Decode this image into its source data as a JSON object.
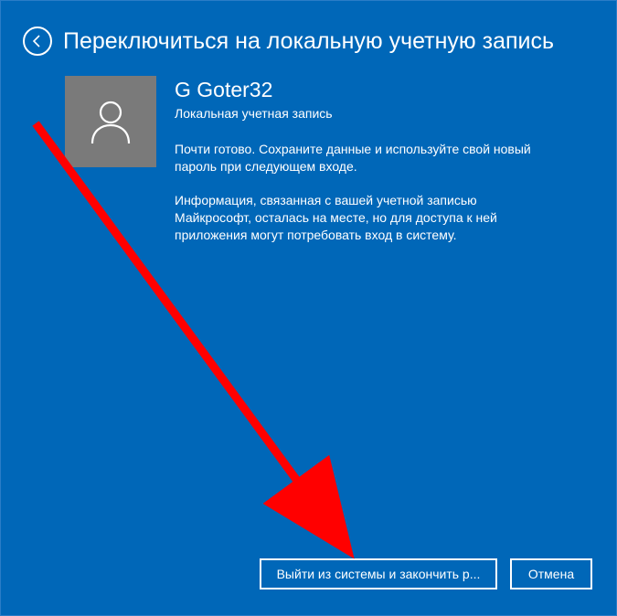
{
  "header": {
    "title": "Переключиться на локальную учетную запись"
  },
  "user": {
    "name": "G Goter32",
    "subtitle": "Локальная учетная запись"
  },
  "body": {
    "paragraph1": "Почти готово. Сохраните данные и используйте свой новый пароль при следующем входе.",
    "paragraph2": "Информация, связанная с вашей учетной записью Майкрософт, осталась на месте, но для доступа к ней приложения могут потребовать вход в систему."
  },
  "footer": {
    "primary": "Выйти из системы и закончить р...",
    "secondary": "Отмена"
  },
  "colors": {
    "background": "#0067b8",
    "avatar_bg": "#7a7a7a",
    "annotation_arrow": "#ff0000"
  }
}
